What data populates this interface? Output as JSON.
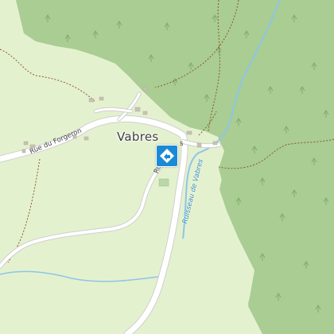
{
  "map": {
    "place_label": "Vabres",
    "street_labels": {
      "forgeron": "Rue du Forgeron",
      "partial_a": "Rue d",
      "partial_b": "s"
    },
    "stream_label": "Ruisseau de Vabres",
    "poi_icon": "map-pin-diamond-icon",
    "colors": {
      "meadow": "#e4f1cf",
      "forest": "#a9cd92",
      "road": "#ffffff",
      "road_casing": "#c9c9c9",
      "stream": "#8ec5e8",
      "trail": "#8b5a2b",
      "poi": "#1a8ad6"
    }
  }
}
